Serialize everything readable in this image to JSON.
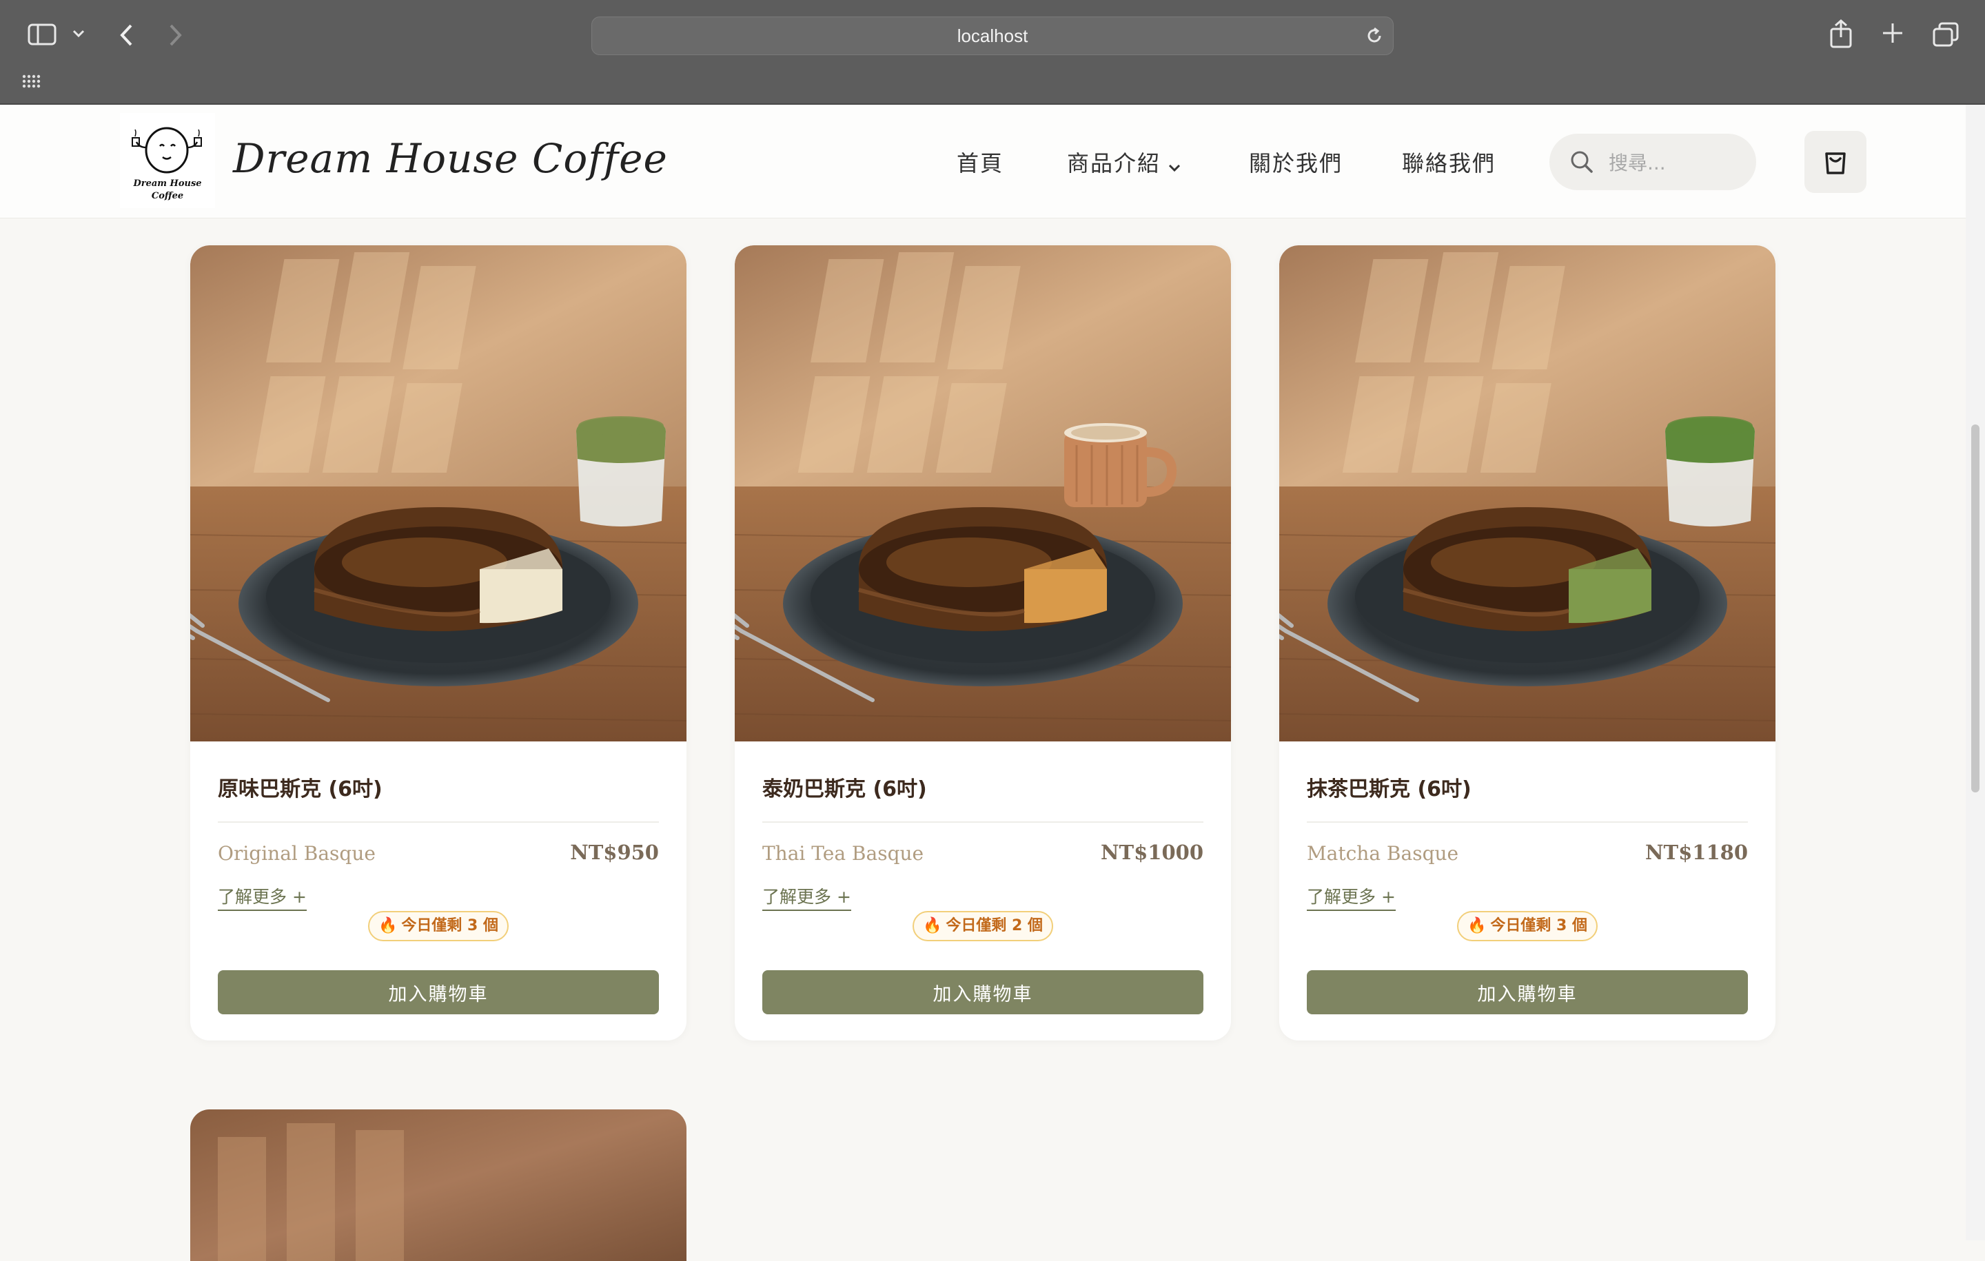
{
  "browser": {
    "url": "localhost"
  },
  "header": {
    "brand": "Dream House Coffee",
    "logo_text": "Dream House Coffee",
    "nav": [
      {
        "label": "首頁"
      },
      {
        "label": "商品介紹"
      },
      {
        "label": "關於我們"
      },
      {
        "label": "聯絡我們"
      }
    ],
    "search_placeholder": "搜尋..."
  },
  "products": [
    {
      "title": "原味巴斯克 (6吋)",
      "en_name": "Original Basque",
      "price": "NT$950",
      "more": "了解更多 +",
      "stock": "今日僅剩 3 個",
      "add": "加入購物車",
      "flavor_color": "#efe6cd",
      "drink_color": "#7b8f4a"
    },
    {
      "title": "泰奶巴斯克 (6吋)",
      "en_name": "Thai Tea Basque",
      "price": "NT$1000",
      "more": "了解更多 +",
      "stock": "今日僅剩 2 個",
      "add": "加入購物車",
      "flavor_color": "#d99a4a",
      "drink_color": "#c9a47a"
    },
    {
      "title": "抹茶巴斯克 (6吋)",
      "en_name": "Matcha Basque",
      "price": "NT$1180",
      "more": "了解更多 +",
      "stock": "今日僅剩 3 個",
      "add": "加入購物車",
      "flavor_color": "#7f9a4c",
      "drink_color": "#5f8a3a"
    }
  ],
  "colors": {
    "accent": "#7f8562",
    "badge_text": "#c2691a",
    "badge_border": "#f2cf7a"
  }
}
